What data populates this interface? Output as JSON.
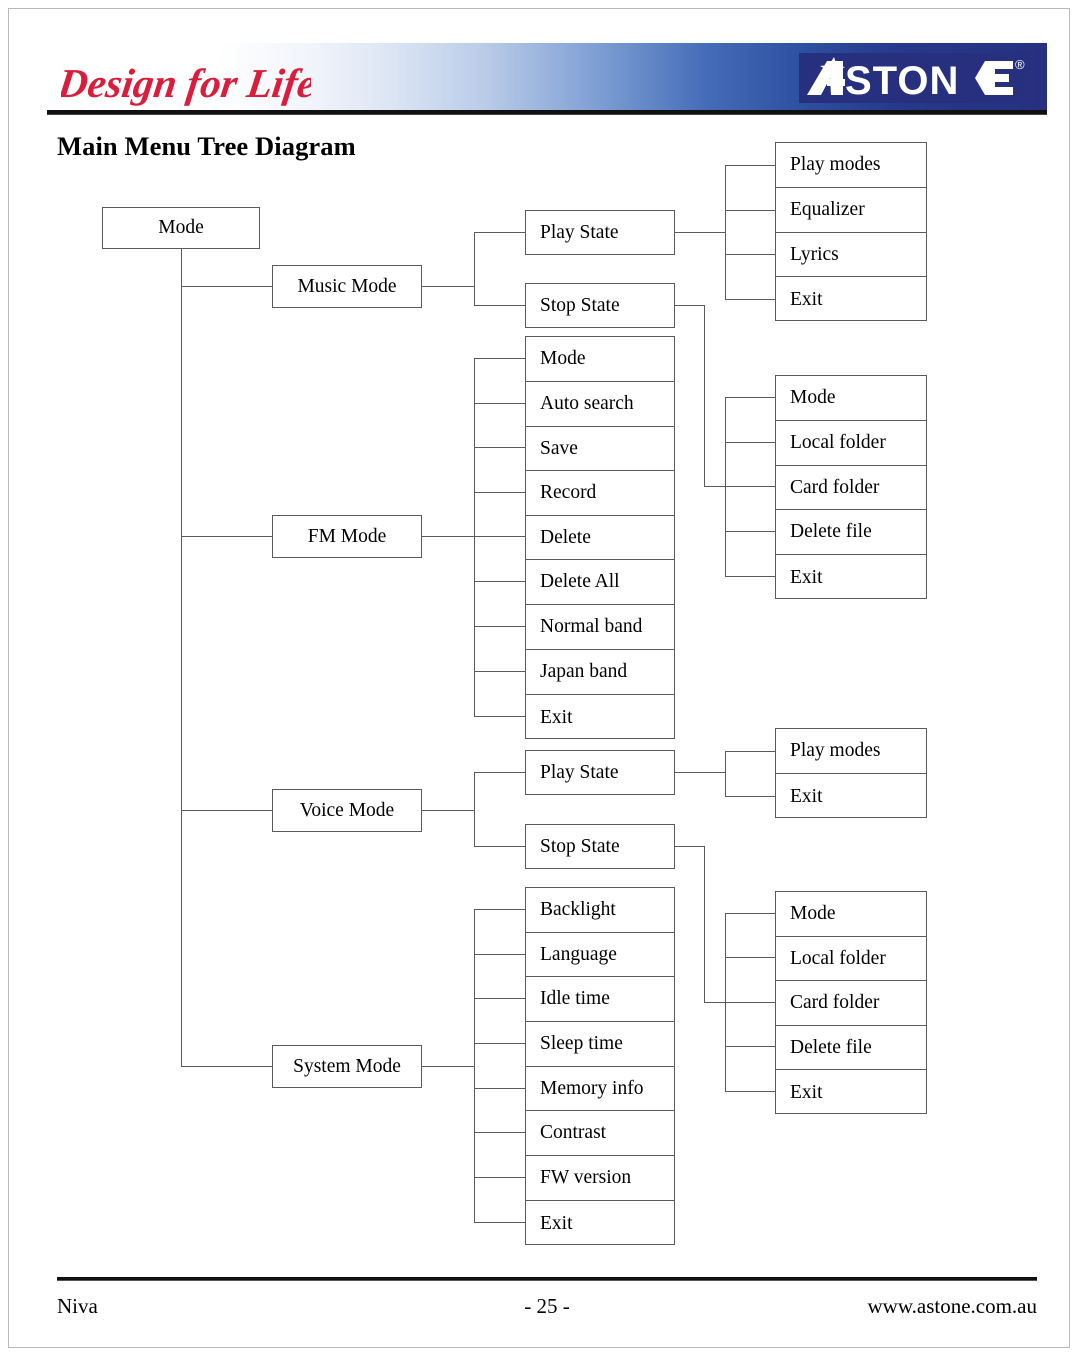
{
  "page": {
    "title": "Main Menu Tree Diagram",
    "tagline": "Design for Life",
    "brand": "ASTONE",
    "brand_mark": "®",
    "accent_red": "#d81e3c",
    "header_blue": "#26307f",
    "line_color": "#5a5a5a"
  },
  "footer": {
    "left": "Niva",
    "center": "- 25 -",
    "right": "www.astone.com.au"
  },
  "chart_data": {
    "type": "diagram",
    "title": "Main Menu Tree Diagram",
    "root": "Mode",
    "branches": [
      {
        "label": "Music Mode",
        "children": [
          {
            "label": "Play State",
            "children": [
              "Play modes",
              "Equalizer",
              "Lyrics",
              "Exit"
            ]
          },
          {
            "label": "Stop State",
            "children": [
              "Mode",
              "Local folder",
              "Card folder",
              "Delete file",
              "Exit"
            ]
          }
        ]
      },
      {
        "label": "FM Mode",
        "children": [
          "Mode",
          "Auto search",
          "Save",
          "Record",
          "Delete",
          "Delete All",
          "Normal band",
          "Japan band",
          "Exit"
        ]
      },
      {
        "label": "Voice Mode",
        "children": [
          {
            "label": "Play State",
            "children": [
              "Play modes",
              "Exit"
            ]
          },
          {
            "label": "Stop State",
            "children": [
              "Mode",
              "Local folder",
              "Card folder",
              "Delete file",
              "Exit"
            ]
          }
        ]
      },
      {
        "label": "System Mode",
        "children": [
          "Backlight",
          "Language",
          "Idle time",
          "Sleep time",
          "Memory info",
          "Contrast",
          "FW version",
          "Exit"
        ]
      }
    ]
  },
  "nodes": {
    "root": "Mode",
    "music_mode": "Music Mode",
    "fm_mode": "FM Mode",
    "voice_mode": "Voice Mode",
    "system_mode": "System Mode",
    "music_play_state": "Play State",
    "music_stop_state": "Stop State",
    "voice_play_state": "Play State",
    "voice_stop_state": "Stop State"
  },
  "panels": {
    "music_play": [
      "Play modes",
      "Equalizer",
      "Lyrics",
      "Exit"
    ],
    "music_stop": [
      "Mode",
      "Local folder",
      "Card folder",
      "Delete file",
      "Exit"
    ],
    "fm_items": [
      "Mode",
      "Auto search",
      "Save",
      "Record",
      "Delete",
      "Delete All",
      "Normal band",
      "Japan band",
      "Exit"
    ],
    "voice_play": [
      "Play modes",
      "Exit"
    ],
    "voice_stop": [
      "Mode",
      "Local folder",
      "Card folder",
      "Delete file",
      "Exit"
    ],
    "system_items": [
      "Backlight",
      "Language",
      "Idle time",
      "Sleep time",
      "Memory info",
      "Contrast",
      "FW version",
      "Exit"
    ]
  }
}
